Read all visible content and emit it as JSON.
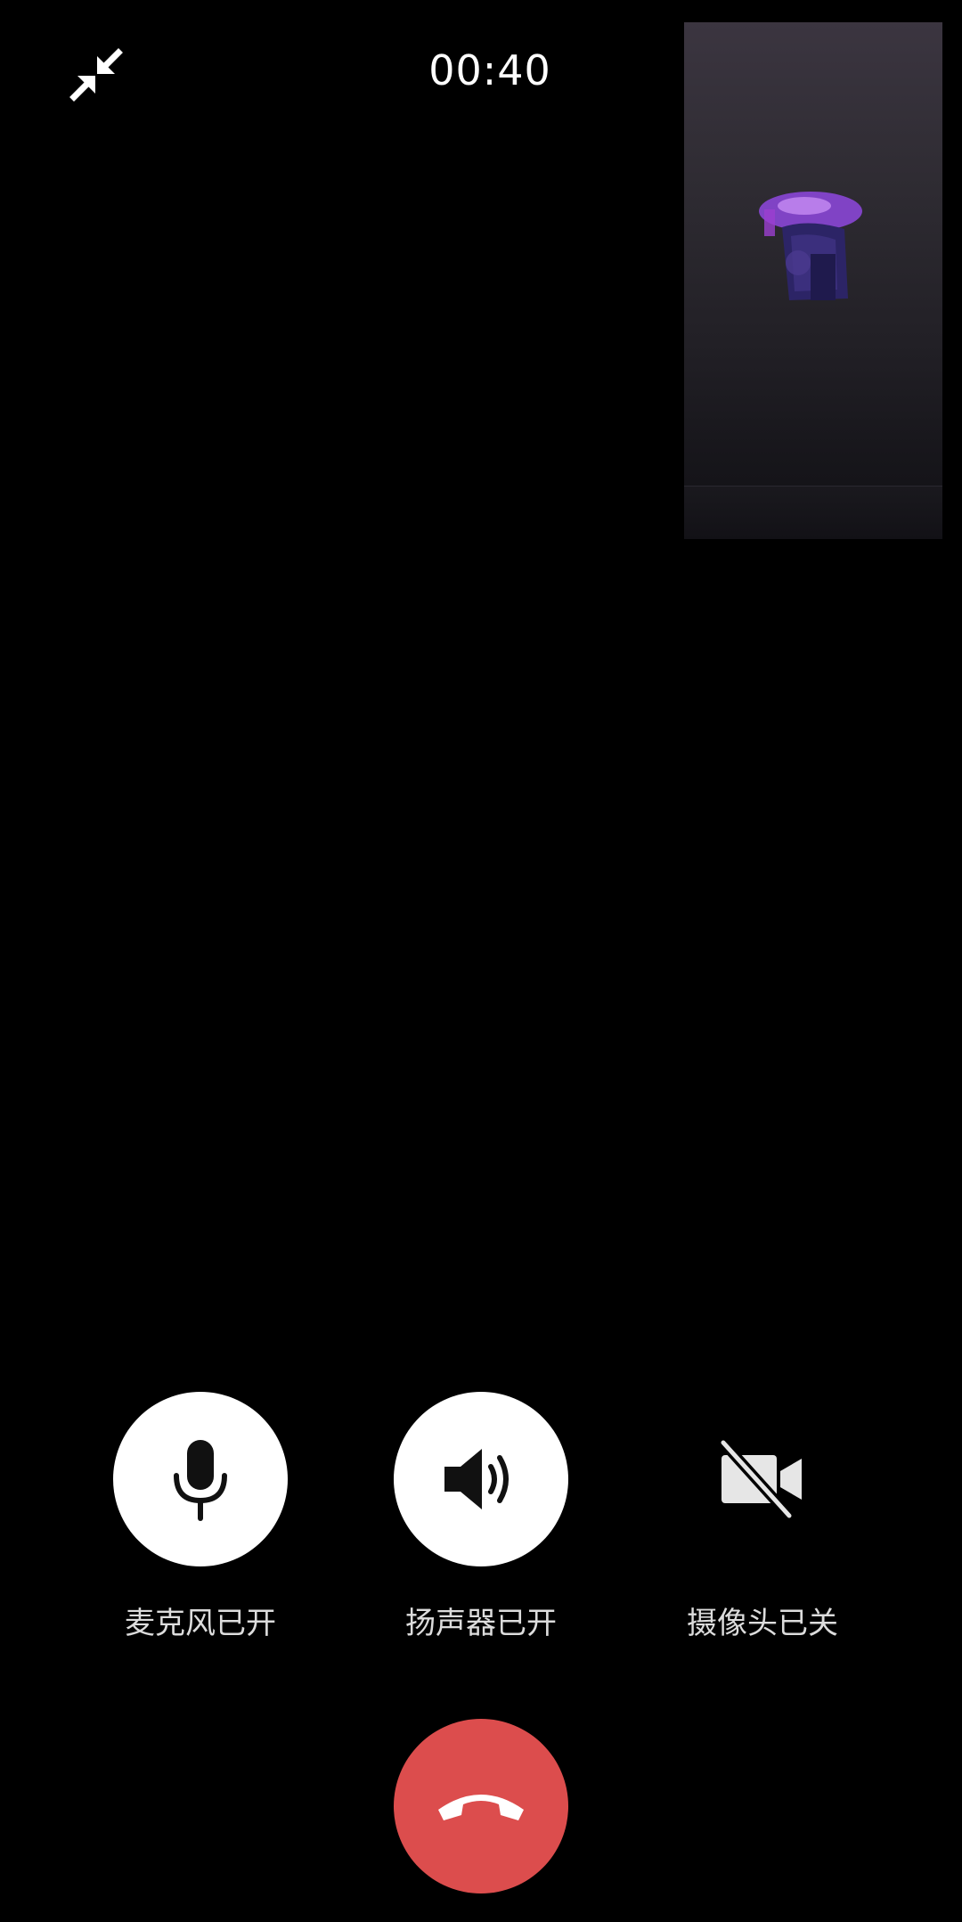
{
  "call": {
    "duration": "00:40"
  },
  "controls": [
    {
      "label": "麦克风已开",
      "icon": "microphone-icon",
      "state": "on"
    },
    {
      "label": "扬声器已开",
      "icon": "speaker-icon",
      "state": "on"
    },
    {
      "label": "摄像头已关",
      "icon": "camera-off-icon",
      "state": "off"
    }
  ],
  "icons": {
    "minimize": "minimize-icon",
    "hangup": "phone-hangup-icon"
  },
  "colors": {
    "background": "#000000",
    "control_on": "#ffffff",
    "hangup": "#dc4d4d",
    "label": "#dcdcdc"
  }
}
